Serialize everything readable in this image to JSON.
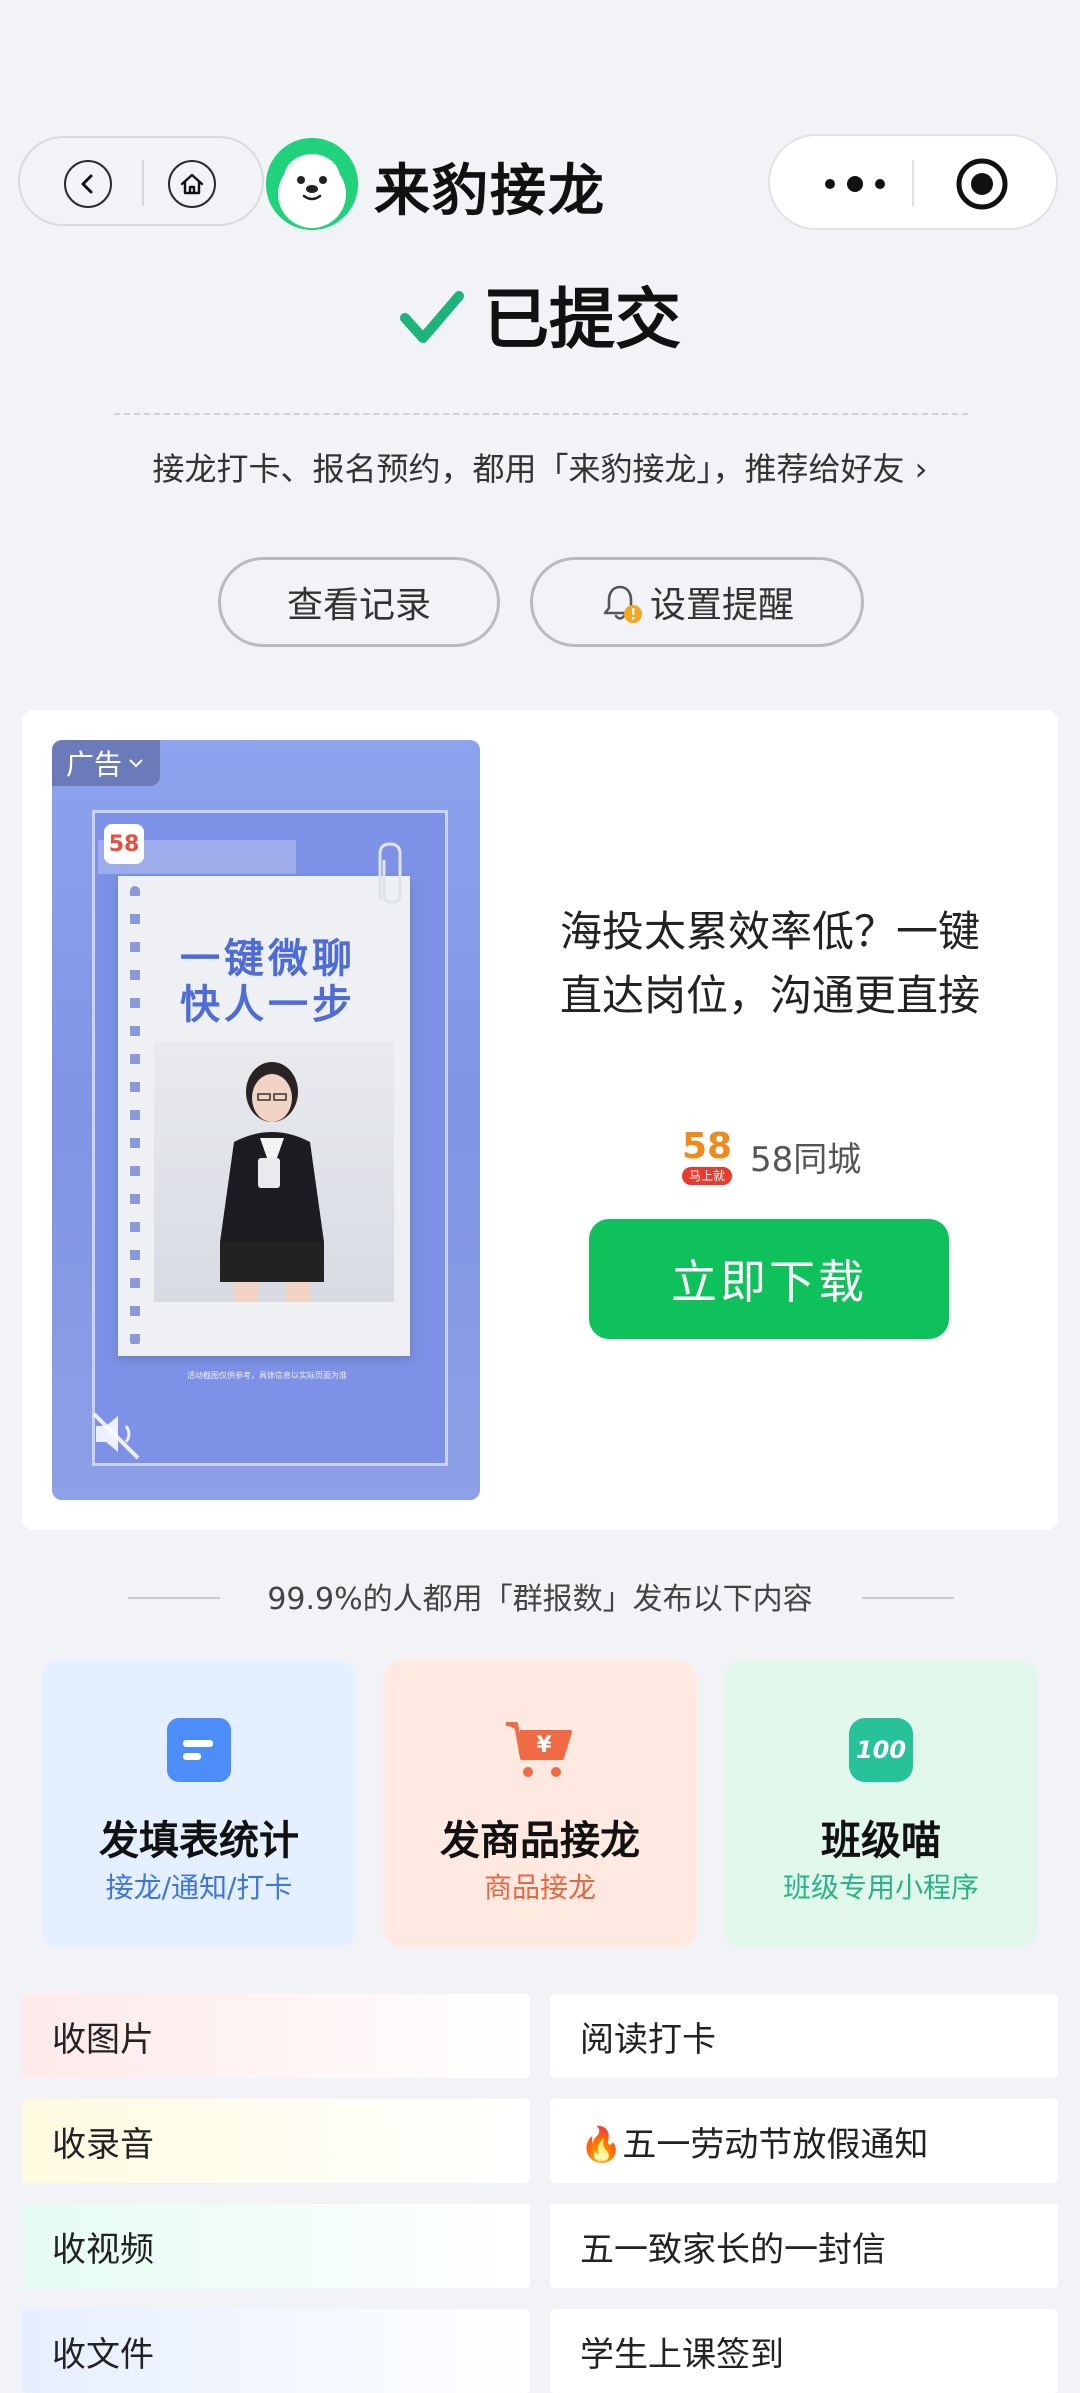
{
  "header": {
    "app_name": "来豹接龙"
  },
  "status": {
    "title": "已提交"
  },
  "recommend": {
    "text": "接龙打卡、报名预约，都用「来豹接龙」，推荐给好友 ›"
  },
  "actions": {
    "view_records": "查看记录",
    "set_reminder": "设置提醒"
  },
  "ad": {
    "tag": "广告",
    "image_headline_1": "一键微聊",
    "image_headline_2": "快人一步",
    "image_logo": "58",
    "image_footnote": "活动截图仅供参考，具体信息以实际页面为准",
    "text": "海投太累效率低？一键直达岗位，沟通更直接",
    "brand": "58同城",
    "brand_logo_text": "58",
    "brand_logo_sub": "马上就",
    "cta": "立即下载"
  },
  "section": {
    "title": "99.9%的人都用「群报数」发布以下内容"
  },
  "features": [
    {
      "title": "发填表统计",
      "subtitle": "接龙/通知/打卡",
      "icon_text": ""
    },
    {
      "title": "发商品接龙",
      "subtitle": "商品接龙",
      "icon_text": "¥"
    },
    {
      "title": "班级喵",
      "subtitle": "班级专用小程序",
      "icon_text": "100"
    }
  ],
  "list_left": [
    "收图片",
    "收录音",
    "收视频",
    "收文件"
  ],
  "list_right": [
    "阅读打卡",
    "🔥五一劳动节放假通知",
    "五一致家长的一封信",
    "学生上课签到"
  ],
  "colors": {
    "green": "#0fc15b",
    "check": "#1db37a",
    "feature_blue": "#4d8df7",
    "feature_orange": "#f06a45",
    "feature_teal": "#28c29a"
  }
}
